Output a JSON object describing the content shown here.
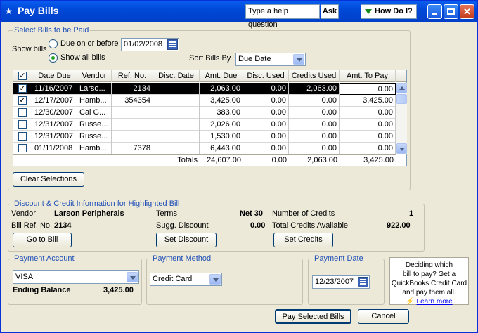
{
  "window": {
    "title": "Pay Bills"
  },
  "help": {
    "placeholder": "Type a help question",
    "ask_label": "Ask",
    "how_do_i_label": "How Do I?"
  },
  "select_bills": {
    "legend": "Select Bills to be Paid",
    "show_bills_label": "Show bills",
    "due_on_before_label": "Due on or before",
    "due_date_value": "01/02/2008",
    "show_all_label": "Show all bills",
    "show_all_selected": true,
    "sort_by_label": "Sort Bills By",
    "sort_by_value": "Due Date"
  },
  "table": {
    "columns": [
      "Date Due",
      "Vendor",
      "Ref. No.",
      "Disc. Date",
      "Amt. Due",
      "Disc. Used",
      "Credits Used",
      "Amt. To Pay"
    ],
    "rows": [
      {
        "checked": "✓",
        "date_due": "11/16/2007",
        "vendor": "Larso...",
        "ref_no": "2134",
        "disc_date": "",
        "amt_due": "2,063.00",
        "disc_used": "0.00",
        "credits_used": "2,063.00",
        "amt_to_pay": "0.00"
      },
      {
        "checked": "✓",
        "date_due": "12/17/2007",
        "vendor": "Hamb...",
        "ref_no": "354354",
        "disc_date": "",
        "amt_due": "3,425.00",
        "disc_used": "0.00",
        "credits_used": "0.00",
        "amt_to_pay": "3,425.00"
      },
      {
        "checked": "",
        "date_due": "12/30/2007",
        "vendor": "Cal G...",
        "ref_no": "",
        "disc_date": "",
        "amt_due": "383.00",
        "disc_used": "0.00",
        "credits_used": "0.00",
        "amt_to_pay": "0.00"
      },
      {
        "checked": "",
        "date_due": "12/31/2007",
        "vendor": "Russe...",
        "ref_no": "",
        "disc_date": "",
        "amt_due": "2,026.00",
        "disc_used": "0.00",
        "credits_used": "0.00",
        "amt_to_pay": "0.00"
      },
      {
        "checked": "",
        "date_due": "12/31/2007",
        "vendor": "Russe...",
        "ref_no": "",
        "disc_date": "",
        "amt_due": "1,530.00",
        "disc_used": "0.00",
        "credits_used": "0.00",
        "amt_to_pay": "0.00"
      },
      {
        "checked": "",
        "date_due": "01/11/2008",
        "vendor": "Hamb...",
        "ref_no": "7378",
        "disc_date": "",
        "amt_due": "6,443.00",
        "disc_used": "0.00",
        "credits_used": "0.00",
        "amt_to_pay": "0.00"
      }
    ],
    "totals": {
      "label": "Totals",
      "amt_due": "24,607.00",
      "disc_used": "0.00",
      "credits_used": "2,063.00",
      "amt_to_pay": "3,425.00"
    }
  },
  "clear_selections_label": "Clear Selections",
  "discount_credit": {
    "legend": "Discount & Credit Information for Highlighted Bill",
    "vendor_label": "Vendor",
    "vendor_value": "Larson Peripherals",
    "bill_ref_label": "Bill Ref. No.",
    "bill_ref_value": "2134",
    "terms_label": "Terms",
    "terms_value": "Net 30",
    "sugg_discount_label": "Sugg. Discount",
    "sugg_discount_value": "0.00",
    "num_credits_label": "Number of Credits",
    "num_credits_value": "1",
    "total_credits_label": "Total Credits Available",
    "total_credits_value": "922.00",
    "go_to_bill_label": "Go to Bill",
    "set_discount_label": "Set Discount",
    "set_credits_label": "Set Credits"
  },
  "payment_account": {
    "legend": "Payment Account",
    "value": "VISA",
    "ending_balance_label": "Ending Balance",
    "ending_balance_value": "3,425.00"
  },
  "payment_method": {
    "legend": "Payment Method",
    "value": "Credit Card"
  },
  "payment_date": {
    "legend": "Payment Date",
    "value": "12/23/2007"
  },
  "tip": {
    "line1": "Deciding which",
    "line2": "bill to pay?  Get a",
    "line3": "QuickBooks Credit Card",
    "line4": "and pay them all.",
    "link": "Learn more"
  },
  "footer": {
    "pay_selected_label": "Pay Selected Bills",
    "cancel_label": "Cancel"
  }
}
